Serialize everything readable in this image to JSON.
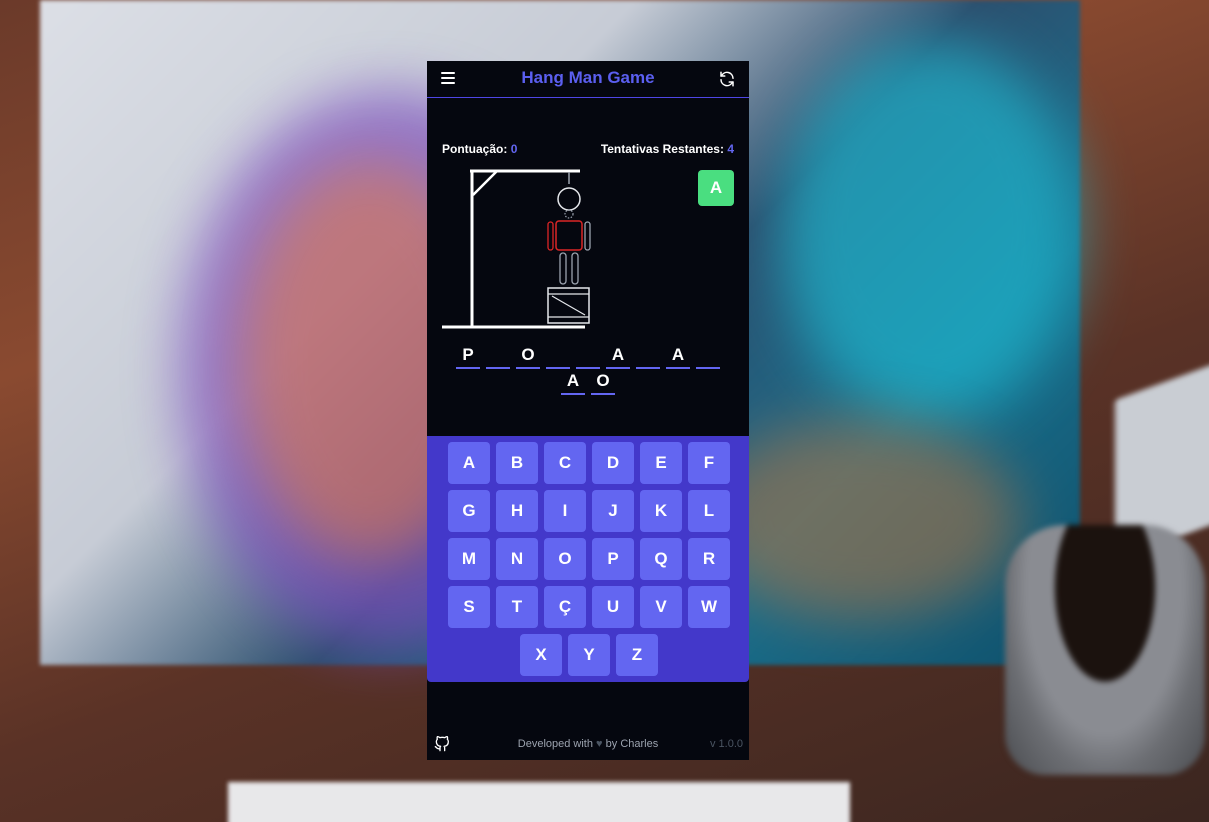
{
  "header": {
    "title": "Hang Man Game",
    "menu_icon": "hamburger-menu-icon",
    "refresh_icon": "refresh-icon"
  },
  "stats": {
    "score_label": "Pontuação:",
    "score_value": "0",
    "tries_label": "Tentativas Restantes:",
    "tries_value": "4"
  },
  "guessed_letters": [
    "A"
  ],
  "word": {
    "row1": [
      "P",
      "",
      "O",
      "",
      "",
      "A",
      "",
      "A",
      ""
    ],
    "row2": [
      "A",
      "O"
    ]
  },
  "keyboard": {
    "keys": [
      "A",
      "B",
      "C",
      "D",
      "E",
      "F",
      "G",
      "H",
      "I",
      "J",
      "K",
      "L",
      "M",
      "N",
      "O",
      "P",
      "Q",
      "R",
      "S",
      "T",
      "Ç",
      "U",
      "V",
      "W",
      "X",
      "Y",
      "Z"
    ]
  },
  "footer": {
    "github_icon": "github-icon",
    "credit_prefix": "Developed with",
    "heart": "♥",
    "credit_suffix": "by Charles",
    "version": "v 1.0.0"
  },
  "colors": {
    "accent": "#6366f1",
    "panel": "#4338ca",
    "background": "#05070f",
    "correct": "#4ade80"
  }
}
